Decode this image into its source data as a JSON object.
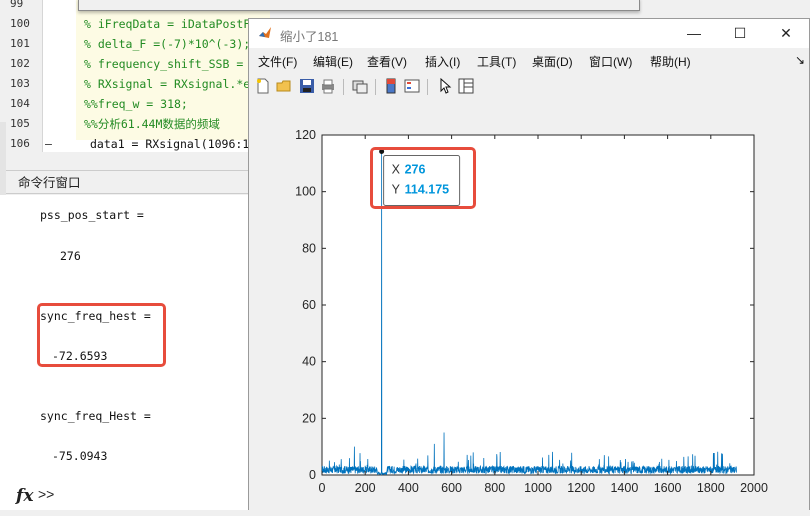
{
  "editor": {
    "lines": [
      {
        "num": "99",
        "text": "",
        "kind": "comment"
      },
      {
        "num": "100",
        "text": "% iFreqData = iDataPostF",
        "kind": "comment"
      },
      {
        "num": "101",
        "text": "% delta_F =(-7)*10^(-3);",
        "kind": "comment"
      },
      {
        "num": "102",
        "text": "% frequency_shift_SSB = ",
        "kind": "comment"
      },
      {
        "num": "103",
        "text": "% RXsignal = RXsignal.*e",
        "kind": "comment"
      },
      {
        "num": "104",
        "text": "%%freq_w = 318;",
        "kind": "comment"
      },
      {
        "num": "105",
        "text": "%%分析61.44M数据的频域",
        "kind": "comment"
      },
      {
        "num": "106",
        "text": "data1 = RXsignal(1096:1",
        "kind": "code",
        "dash": "–"
      }
    ]
  },
  "command_window": {
    "title": "命令行窗口",
    "lines": [
      "pss_pos_start =",
      "276",
      "sync_freq_hest =",
      "-72.6593",
      "sync_freq_Hest =",
      "-75.0943"
    ],
    "prompt_symbol": "fx",
    "prompt_arrows": ">>"
  },
  "figure": {
    "title": "缩小了181",
    "window_buttons": {
      "minimize": "—",
      "maximize": "☐",
      "close": "✕"
    },
    "menu": [
      "文件(F)",
      "编辑(E)",
      "查看(V)",
      "插入(I)",
      "工具(T)",
      "桌面(D)",
      "窗口(W)",
      "帮助(H)"
    ],
    "overflow_arrow": "↘",
    "datatip": {
      "x_label": "X",
      "x_value": "276",
      "y_label": "Y",
      "y_value": "114.175"
    },
    "colors": {
      "line": "#0072bd",
      "datatip_value": "#0096dc",
      "highlight": "#e74c3c"
    }
  },
  "chart_data": {
    "type": "line",
    "x_range": [
      0,
      1920
    ],
    "xlim": [
      0,
      2000
    ],
    "ylim": [
      0,
      120
    ],
    "x_ticks": [
      "0",
      "200",
      "400",
      "600",
      "800",
      "1000",
      "1200",
      "1400",
      "1600",
      "1800",
      "2000"
    ],
    "y_ticks": [
      "0",
      "20",
      "40",
      "60",
      "80",
      "100",
      "120"
    ],
    "peak": {
      "x": 276,
      "y": 114.175
    },
    "noise_floor_typical": 2.5,
    "notable_spikes": [
      {
        "x": 150,
        "y": 10
      },
      {
        "x": 565,
        "y": 15
      },
      {
        "x": 520,
        "y": 11
      },
      {
        "x": 700,
        "y": 8
      }
    ],
    "grid": false,
    "legend": "none"
  }
}
